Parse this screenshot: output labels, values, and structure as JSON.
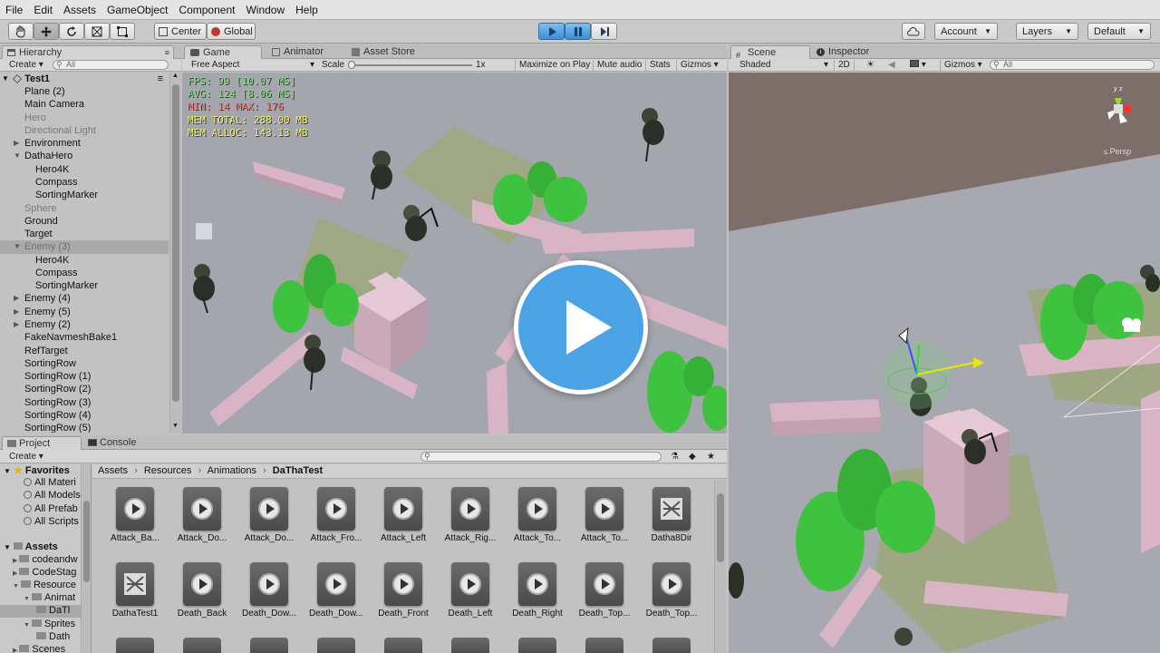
{
  "menu": [
    "File",
    "Edit",
    "Assets",
    "GameObject",
    "Component",
    "Window",
    "Help"
  ],
  "toolbar": {
    "center_label": "Center",
    "global_label": "Global",
    "account_label": "Account",
    "layers_label": "Layers",
    "layout_label": "Default"
  },
  "hierarchy": {
    "tab": "Hierarchy",
    "create": "Create",
    "search_placeholder": "All",
    "scene": "Test1",
    "items": [
      {
        "label": "Plane (2)",
        "indent": 1,
        "style": "normal",
        "arrow": ""
      },
      {
        "label": "Main Camera",
        "indent": 1,
        "style": "normal",
        "arrow": ""
      },
      {
        "label": "Hero",
        "indent": 1,
        "style": "grey",
        "arrow": ""
      },
      {
        "label": "Directional Light",
        "indent": 1,
        "style": "grey",
        "arrow": ""
      },
      {
        "label": "Environment",
        "indent": 1,
        "style": "normal",
        "arrow": "right"
      },
      {
        "label": "DathaHero",
        "indent": 1,
        "style": "normal",
        "arrow": "down"
      },
      {
        "label": "Hero4K",
        "indent": 2,
        "style": "normal",
        "arrow": ""
      },
      {
        "label": "Compass",
        "indent": 2,
        "style": "normal",
        "arrow": ""
      },
      {
        "label": "SortingMarker",
        "indent": 2,
        "style": "normal",
        "arrow": ""
      },
      {
        "label": "Sphere",
        "indent": 1,
        "style": "grey",
        "arrow": ""
      },
      {
        "label": "Ground",
        "indent": 1,
        "style": "normal",
        "arrow": ""
      },
      {
        "label": "Target",
        "indent": 1,
        "style": "normal",
        "arrow": ""
      },
      {
        "label": "Enemy (3)",
        "indent": 1,
        "style": "selected",
        "arrow": "down"
      },
      {
        "label": "Hero4K",
        "indent": 2,
        "style": "normal",
        "arrow": ""
      },
      {
        "label": "Compass",
        "indent": 2,
        "style": "normal",
        "arrow": ""
      },
      {
        "label": "SortingMarker",
        "indent": 2,
        "style": "normal",
        "arrow": ""
      },
      {
        "label": "Enemy (4)",
        "indent": 1,
        "style": "normal",
        "arrow": "right"
      },
      {
        "label": "Enemy (5)",
        "indent": 1,
        "style": "normal",
        "arrow": "right"
      },
      {
        "label": "Enemy (2)",
        "indent": 1,
        "style": "normal",
        "arrow": "right"
      },
      {
        "label": "FakeNavmeshBake1",
        "indent": 1,
        "style": "normal",
        "arrow": ""
      },
      {
        "label": "RefTarget",
        "indent": 1,
        "style": "normal",
        "arrow": ""
      },
      {
        "label": "SortingRow",
        "indent": 1,
        "style": "normal",
        "arrow": ""
      },
      {
        "label": "SortingRow (1)",
        "indent": 1,
        "style": "normal",
        "arrow": ""
      },
      {
        "label": "SortingRow (2)",
        "indent": 1,
        "style": "normal",
        "arrow": ""
      },
      {
        "label": "SortingRow (3)",
        "indent": 1,
        "style": "normal",
        "arrow": ""
      },
      {
        "label": "SortingRow (4)",
        "indent": 1,
        "style": "normal",
        "arrow": ""
      },
      {
        "label": "SortingRow (5)",
        "indent": 1,
        "style": "normal",
        "arrow": ""
      }
    ]
  },
  "game": {
    "tabs": [
      "Game",
      "Animator",
      "Asset Store"
    ],
    "aspect": "Free Aspect",
    "scale_label": "Scale",
    "scale_value": "1x",
    "buttons": [
      "Maximize on Play",
      "Mute audio",
      "Stats",
      "Gizmos"
    ],
    "stats": [
      {
        "text": "FPS: 99 [10.07 MS]",
        "color": "#7de07d"
      },
      {
        "text": "AVG: 124 [8.06 MS]",
        "color": "#7de07d"
      },
      {
        "text": "MIN: 14 MAX: 176",
        "color": "#ff7777"
      },
      {
        "text": "MEM TOTAL: 288.00 MB",
        "color": "#f2f26a"
      },
      {
        "text": "MEM ALLOC: 143.13 MB",
        "color": "#f2f26a"
      }
    ]
  },
  "scene": {
    "tabs": [
      "Scene",
      "Inspector"
    ],
    "shading": "Shaded",
    "mode_2d": "2D",
    "gizmos": "Gizmos",
    "search_placeholder": "All",
    "persp_label": "Persp"
  },
  "project": {
    "tabs": [
      "Project",
      "Console"
    ],
    "create": "Create",
    "breadcrumb": [
      "Assets",
      "Resources",
      "Animations",
      "DaThaTest"
    ],
    "favorites_label": "Favorites",
    "favorites": [
      "All Materi",
      "All Models",
      "All Prefab",
      "All Scripts"
    ],
    "assets_label": "Assets",
    "folders": [
      {
        "label": "codeandw",
        "indent": 1
      },
      {
        "label": "CodeStag",
        "indent": 1
      },
      {
        "label": "Resource",
        "indent": 1
      },
      {
        "label": "Animat",
        "indent": 2
      },
      {
        "label": "DaTl",
        "indent": 3
      },
      {
        "label": "Sprites",
        "indent": 2
      },
      {
        "label": "Dath",
        "indent": 3
      },
      {
        "label": "Scenes",
        "indent": 1
      }
    ],
    "assets_row1": [
      {
        "label": "Attack_Ba...",
        "kind": "anim"
      },
      {
        "label": "Attack_Do...",
        "kind": "anim"
      },
      {
        "label": "Attack_Do...",
        "kind": "anim"
      },
      {
        "label": "Attack_Fro...",
        "kind": "anim"
      },
      {
        "label": "Attack_Left",
        "kind": "anim"
      },
      {
        "label": "Attack_Rig...",
        "kind": "anim"
      },
      {
        "label": "Attack_To...",
        "kind": "anim"
      },
      {
        "label": "Attack_To...",
        "kind": "anim"
      },
      {
        "label": "Datha8Dir",
        "kind": "controller"
      }
    ],
    "assets_row2": [
      {
        "label": "DathaTest1",
        "kind": "controller"
      },
      {
        "label": "Death_Back",
        "kind": "anim"
      },
      {
        "label": "Death_Dow...",
        "kind": "anim"
      },
      {
        "label": "Death_Dow...",
        "kind": "anim"
      },
      {
        "label": "Death_Front",
        "kind": "anim"
      },
      {
        "label": "Death_Left",
        "kind": "anim"
      },
      {
        "label": "Death_Right",
        "kind": "anim"
      },
      {
        "label": "Death_Top...",
        "kind": "anim"
      },
      {
        "label": "Death_Top...",
        "kind": "anim"
      }
    ]
  },
  "colors": {
    "accent": "#4ba3e6",
    "selection": "#a9a9a9",
    "game_bg": "#a4a6ae",
    "scene_bg": "#a7a8b0",
    "pink_block": "#d8b4c4",
    "tree_green": "#3fc23f",
    "ground_patch": "#9ea77a"
  }
}
